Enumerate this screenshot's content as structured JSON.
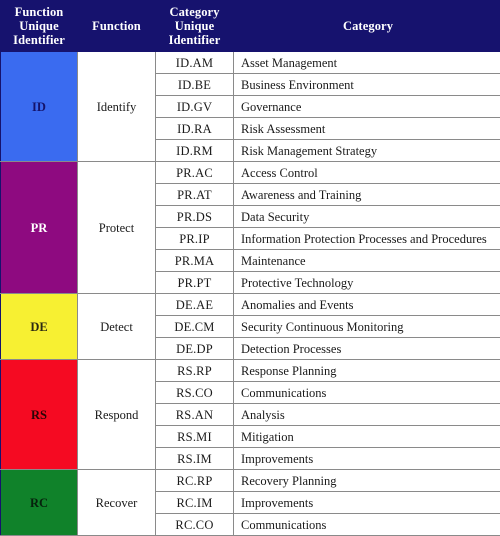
{
  "table": {
    "headers": {
      "function_unique_identifier": "Function\nUnique\nIdentifier",
      "function_unique_identifier_l1": "Function",
      "function_unique_identifier_l2": "Unique",
      "function_unique_identifier_l3": "Identifier",
      "function": "Function",
      "category_unique_identifier_l1": "Category",
      "category_unique_identifier_l2": "Unique",
      "category_unique_identifier_l3": "Identifier",
      "category": "Category"
    },
    "colors": {
      "header_background": "#16126e",
      "header_text": "#ffffff",
      "grid_line": "#8a8a8a",
      "cell_background": "#ffffff",
      "cell_text": "#1a1a1a",
      "id_block": "#3a6bf0",
      "pr_block": "#8e0a80",
      "de_block": "#f7f032",
      "rs_block": "#f50a22",
      "rc_block": "#10822a"
    },
    "functions": [
      {
        "unique_identifier": "ID",
        "name": "Identify",
        "color": "#3a6bf0",
        "categories": [
          {
            "unique_identifier": "ID.AM",
            "name": "Asset Management"
          },
          {
            "unique_identifier": "ID.BE",
            "name": "Business Environment"
          },
          {
            "unique_identifier": "ID.GV",
            "name": "Governance"
          },
          {
            "unique_identifier": "ID.RA",
            "name": "Risk Assessment"
          },
          {
            "unique_identifier": "ID.RM",
            "name": "Risk Management Strategy"
          }
        ]
      },
      {
        "unique_identifier": "PR",
        "name": "Protect",
        "color": "#8e0a80",
        "categories": [
          {
            "unique_identifier": "PR.AC",
            "name": "Access Control"
          },
          {
            "unique_identifier": "PR.AT",
            "name": "Awareness and Training"
          },
          {
            "unique_identifier": "PR.DS",
            "name": "Data Security"
          },
          {
            "unique_identifier": "PR.IP",
            "name": "Information Protection Processes and Procedures"
          },
          {
            "unique_identifier": "PR.MA",
            "name": "Maintenance"
          },
          {
            "unique_identifier": "PR.PT",
            "name": "Protective Technology"
          }
        ]
      },
      {
        "unique_identifier": "DE",
        "name": "Detect",
        "color": "#f7f032",
        "categories": [
          {
            "unique_identifier": "DE.AE",
            "name": "Anomalies and Events"
          },
          {
            "unique_identifier": "DE.CM",
            "name": "Security Continuous Monitoring"
          },
          {
            "unique_identifier": "DE.DP",
            "name": "Detection Processes"
          }
        ]
      },
      {
        "unique_identifier": "RS",
        "name": "Respond",
        "color": "#f50a22",
        "categories": [
          {
            "unique_identifier": "RS.RP",
            "name": "Response Planning"
          },
          {
            "unique_identifier": "RS.CO",
            "name": "Communications"
          },
          {
            "unique_identifier": "RS.AN",
            "name": "Analysis"
          },
          {
            "unique_identifier": "RS.MI",
            "name": "Mitigation"
          },
          {
            "unique_identifier": "RS.IM",
            "name": "Improvements"
          }
        ]
      },
      {
        "unique_identifier": "RC",
        "name": "Recover",
        "color": "#10822a",
        "categories": [
          {
            "unique_identifier": "RC.RP",
            "name": "Recovery Planning"
          },
          {
            "unique_identifier": "RC.IM",
            "name": "Improvements"
          },
          {
            "unique_identifier": "RC.CO",
            "name": "Communications"
          }
        ]
      }
    ]
  }
}
